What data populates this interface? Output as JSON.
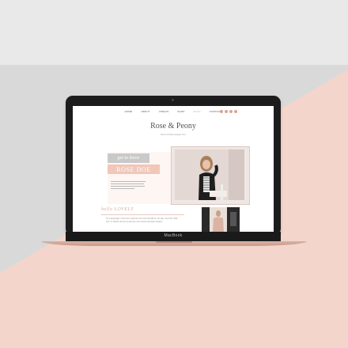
{
  "device": {
    "chin_label": "MacBook"
  },
  "site": {
    "nav": [
      "HOME",
      "ABOUT",
      "VIDEOS",
      "SHOP",
      "BLOG",
      "CONTACT"
    ],
    "nav_active_index": 4,
    "logo": "Rose & Peony",
    "tagline": "Best Little Blog Template Ever",
    "hero": {
      "kicker": "get to know",
      "name": "ROSE DOE"
    },
    "hello_heading": "hello LOVELY",
    "paragraph": "I'm a paragraph. Click here to add your own text and edit me. It's easy. Just click \"Edit Text\" or double click me to add your own content and make changes."
  },
  "colors": {
    "accent": "#d7a99b",
    "name_badge": "#f0c7b9",
    "kicker_badge": "#c9c9c9",
    "backdrop_pink": "#f3d5cb",
    "backdrop_grey": "#d9d9d9"
  },
  "icons": [
    "social-icon-1",
    "social-icon-2",
    "social-icon-3",
    "social-icon-4"
  ]
}
